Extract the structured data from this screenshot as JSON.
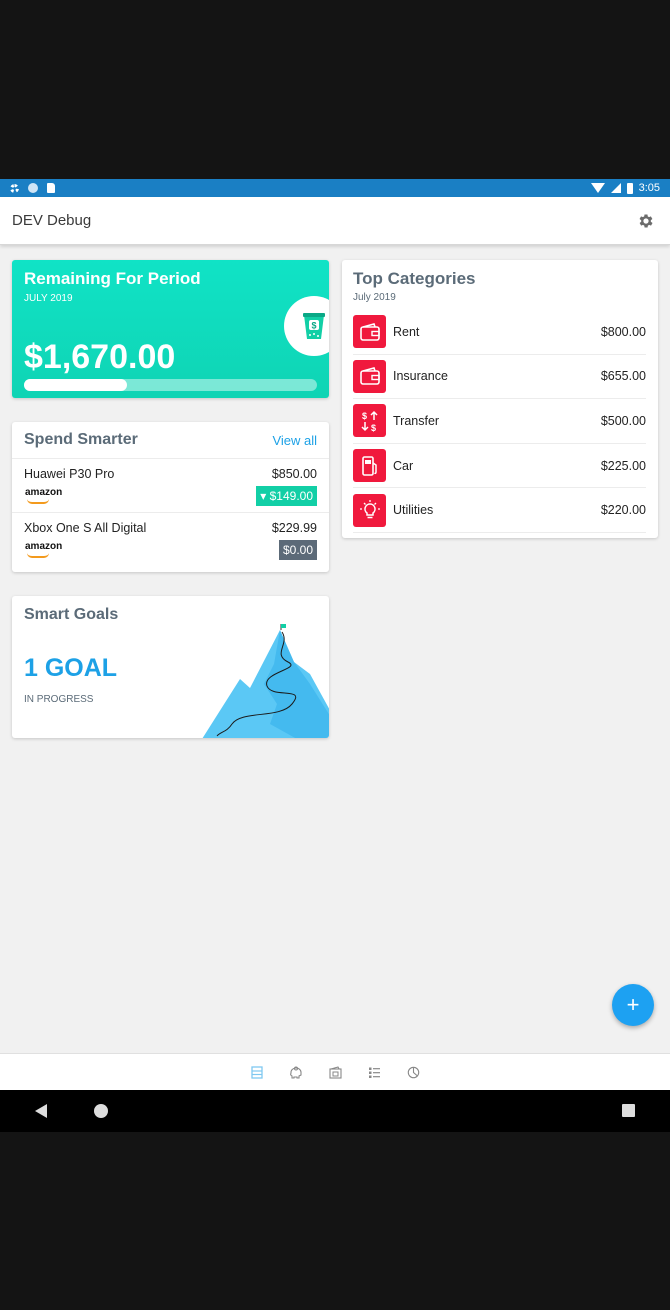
{
  "status_bar": {
    "time": "3:05"
  },
  "app_bar": {
    "title": "DEV Debug",
    "settings_icon": "gear-icon"
  },
  "remaining": {
    "title": "Remaining For Period",
    "period": "JULY 2019",
    "amount": "$1,670.00",
    "progress_fraction": 0.35,
    "badge_icon": "money-jar-icon",
    "color": "#10e3c6"
  },
  "spend_smarter": {
    "title": "Spend Smarter",
    "view_all": "View all",
    "items": [
      {
        "name": "Huawei P30 Pro",
        "price": "$850.00",
        "store": "amazon",
        "discount": "▾ $149.00"
      },
      {
        "name": "Xbox One S All Digital",
        "price": "$229.99",
        "store": "amazon",
        "discount": "$0.00"
      }
    ]
  },
  "smart_goals": {
    "title": "Smart Goals",
    "count": "1 GOAL",
    "status": "IN PROGRESS",
    "illustration": "mountain-illustration"
  },
  "top_categories": {
    "title": "Top Categories",
    "period": "July 2019",
    "accent": "#f0193d",
    "items": [
      {
        "label": "Rent",
        "amount": "$800.00",
        "icon": "wallet-icon"
      },
      {
        "label": "Insurance",
        "amount": "$655.00",
        "icon": "wallet-icon"
      },
      {
        "label": "Transfer",
        "amount": "$500.00",
        "icon": "transfer-icon"
      },
      {
        "label": "Car",
        "amount": "$225.00",
        "icon": "fuel-icon"
      },
      {
        "label": "Utilities",
        "amount": "$220.00",
        "icon": "lightbulb-icon"
      }
    ]
  },
  "fab": {
    "label": "+"
  },
  "bottom_nav": [
    "dashboard-icon",
    "savings-icon",
    "wallet-icon",
    "list-icon",
    "pie-chart-icon"
  ]
}
